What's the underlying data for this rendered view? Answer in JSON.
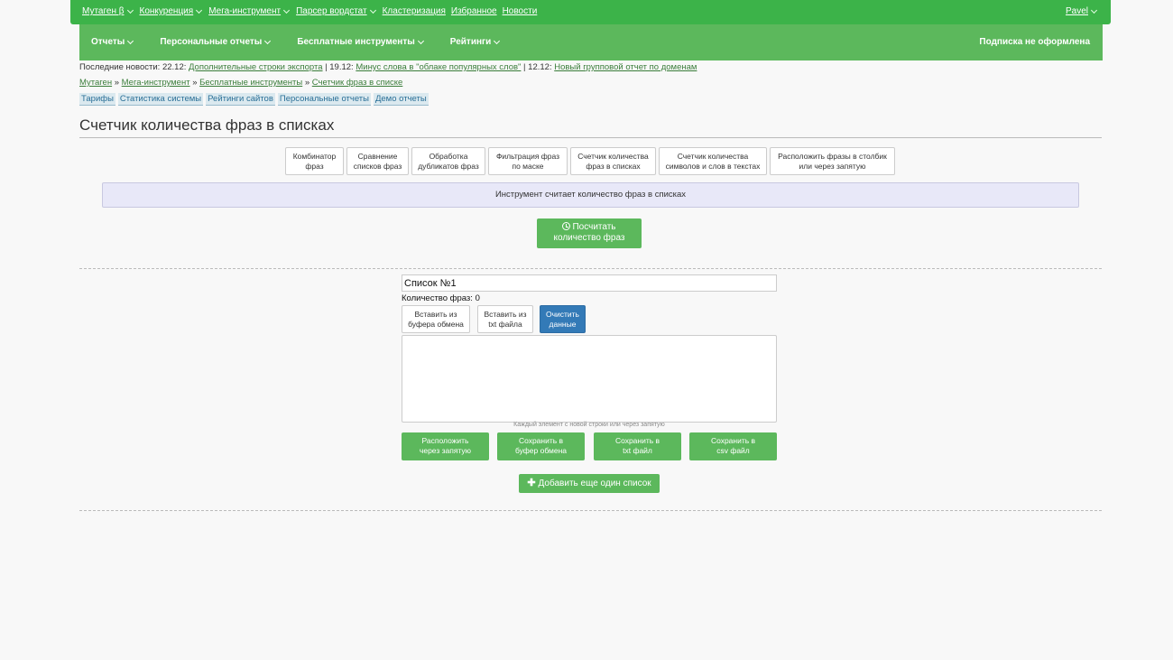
{
  "topbar": {
    "items": [
      "Мутаген β",
      "Конкуренция",
      "Мега-инструмент",
      "Парсер вордстат",
      "Кластеризация",
      "Избранное",
      "Новости"
    ],
    "user": "Pavel"
  },
  "nav": {
    "items": [
      "Отчеты",
      "Персональные отчеты",
      "Бесплатные инструменты",
      "Рейтинги"
    ],
    "subscription": "Подписка не оформлена"
  },
  "news": {
    "prefix": "Последние новости: ",
    "date1": "22.12: ",
    "link1": "Дополнительные строки экспорта",
    "sep1": " | 19.12: ",
    "link2": "Минус слова в \"облаке популярных слов\"",
    "sep2": " | 12.12: ",
    "link3": "Новый групповой отчет по доменам"
  },
  "breadcrumb": {
    "items": [
      "Мутаген",
      "Мега-инструмент",
      "Бесплатные инструменты",
      "Счетчик фраз в списке"
    ],
    "separator": " » "
  },
  "quicklinks": [
    "Тарифы",
    "Статистика системы",
    "Рейтинги сайтов",
    "Персональные отчеты",
    "Демо отчеты"
  ],
  "page": {
    "title": "Счетчик количества фраз в списках",
    "info": "Инструмент считает количество фраз в списках",
    "count_button": [
      "Посчитать",
      "количество фраз"
    ]
  },
  "tools": [
    [
      "Комбинатор",
      "фраз"
    ],
    [
      "Сравнение",
      "списков фраз"
    ],
    [
      "Обработка",
      "дубликатов фраз"
    ],
    [
      "Фильтрация фраз",
      "по маске"
    ],
    [
      "Счетчик количества",
      "фраз в списках"
    ],
    [
      "Счетчик количества",
      "символов и слов в текстах"
    ],
    [
      "Расположить фразы в столбик",
      "или через запятую"
    ]
  ],
  "list": {
    "title_value": "Список №1",
    "count_label": "Количество фраз: 0",
    "paste_clipboard": [
      "Вставить из",
      "буфера обмена"
    ],
    "paste_txt": [
      "Вставить из",
      "txt файла"
    ],
    "clear": [
      "Очистить",
      "данные"
    ],
    "hint": "Каждый элемент с новой строки или через запятую",
    "save_buttons": [
      [
        "Расположить",
        "через запятую"
      ],
      [
        "Сохранить в",
        "буфер обмена"
      ],
      [
        "Сохранить в",
        "txt файл"
      ],
      [
        "Сохранить в",
        "csv файл"
      ]
    ],
    "add_list": "Добавить еще один список"
  }
}
